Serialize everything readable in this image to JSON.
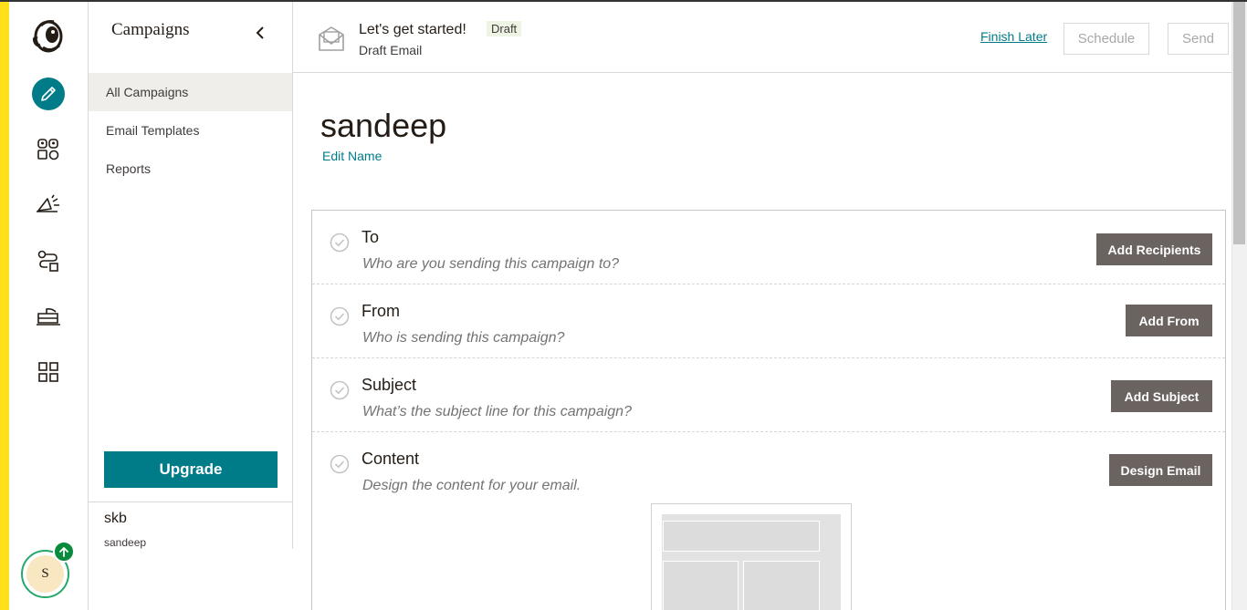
{
  "brand": {
    "accent": "#007c89",
    "yellow": "#ffe01b",
    "button_dark": "#6b6360"
  },
  "rail": {
    "icons": [
      "mailchimp-logo-icon",
      "pencil-icon",
      "audience-icon",
      "megaphone-icon",
      "automation-icon",
      "website-icon",
      "grid-icon"
    ],
    "avatar_initial": "S"
  },
  "panel": {
    "title": "Campaigns",
    "nav": [
      "All Campaigns",
      "Email Templates",
      "Reports"
    ],
    "selected": "All Campaigns",
    "upgrade_label": "Upgrade",
    "account_name": "skb",
    "account_user": "sandeep"
  },
  "header": {
    "title": "Let's get started!",
    "badge": "Draft",
    "subtitle": "Draft Email",
    "finish_later": "Finish Later",
    "schedule": "Schedule",
    "send": "Send"
  },
  "campaign": {
    "name": "sandeep",
    "edit_name": "Edit Name"
  },
  "checklist": [
    {
      "title": "To",
      "desc": "Who are you sending this campaign to?",
      "button": "Add Recipients"
    },
    {
      "title": "From",
      "desc": "Who is sending this campaign?",
      "button": "Add From"
    },
    {
      "title": "Subject",
      "desc": "What’s the subject line for this campaign?",
      "button": "Add Subject"
    },
    {
      "title": "Content",
      "desc": "Design the content for your email.",
      "button": "Design Email"
    }
  ]
}
